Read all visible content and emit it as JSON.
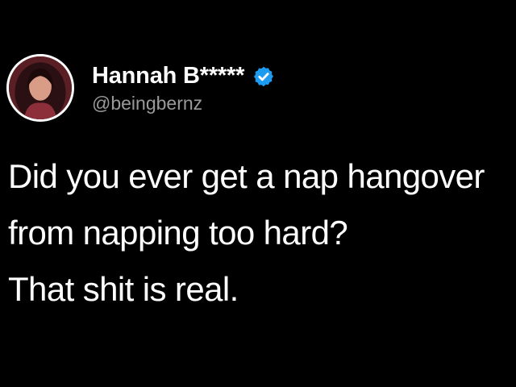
{
  "author": {
    "display_name": "Hannah B*****",
    "handle": "@beingbernz",
    "verified": true,
    "avatar_icon": "profile-photo",
    "verified_icon": "verified-badge-icon"
  },
  "tweet": {
    "lines": [
      "Did you ever get a nap hangover",
      "from napping too hard?",
      "That shit is real."
    ]
  },
  "colors": {
    "background": "#000000",
    "text": "#ffffff",
    "handle": "#9a9a9a",
    "verified_badge": "#1d9bf0"
  }
}
